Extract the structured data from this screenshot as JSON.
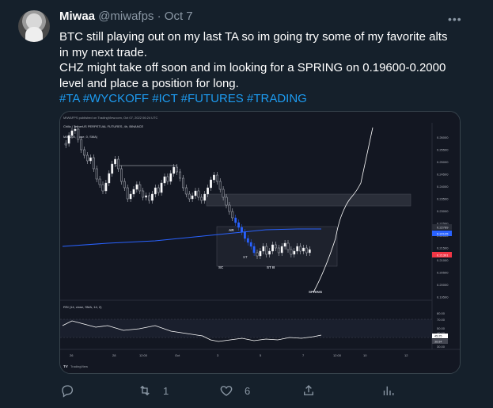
{
  "tweet": {
    "name": "Miwaa",
    "handle": "@miwafps",
    "separator": "·",
    "date": "Oct 7",
    "lines": [
      "BTC still playing out on my last TA so im going try some of my favorite alts",
      "in my next trade.",
      "CHZ might take off soon and im looking for a SPRING on 0.19600-0.2000",
      "level and place a position for long."
    ],
    "hashtags": "#TA #WYCKOFF #ICT #FUTURES #TRADING",
    "more_icon": "ellipsis-icon"
  },
  "chart": {
    "header": "MIWAFPS published on TradingView.com, Oct 07, 2022 06:24 UTC",
    "symbol_line": "Chiliz / TetherUS PERPETUAL FUTURES, 4h, BINANCE",
    "ma_line": "MA (200, close, 0, SMA)",
    "indicator_label": "RSI (14, close, SMA, 14, 2)",
    "watermark": "TradingView",
    "price_ticks": [
      "0.26000",
      "0.25500",
      "0.25000",
      "0.24500",
      "0.24000",
      "0.23500",
      "0.23000",
      "0.22500",
      "0.22000",
      "0.21500",
      "0.21000",
      "0.20500",
      "0.20000",
      "0.19500"
    ],
    "price_badges": [
      "0.22789",
      "0.22125",
      "0.21391"
    ],
    "rsi_ticks": [
      "80.00",
      "70.00",
      "50.00",
      "40.00",
      "30.00"
    ],
    "rsi_badges": [
      "45.25",
      "38.84"
    ],
    "time_ticks": [
      "26",
      "28",
      "12:00",
      "Oct",
      "3",
      "5",
      "7",
      "12:00",
      "10",
      "12"
    ],
    "annotations": [
      "AR",
      "ST",
      "SC",
      "ST B",
      "SPRING"
    ],
    "chart_data": {
      "type": "candlestick",
      "annotations": [
        "AR",
        "ST",
        "SC",
        "ST B",
        "SPRING"
      ]
    }
  },
  "actions": {
    "reply_icon": "reply-icon",
    "retweet_icon": "retweet-icon",
    "retweet_count": "1",
    "like_icon": "heart-icon",
    "like_count": "6",
    "share_icon": "share-icon",
    "analytics_icon": "analytics-icon"
  }
}
